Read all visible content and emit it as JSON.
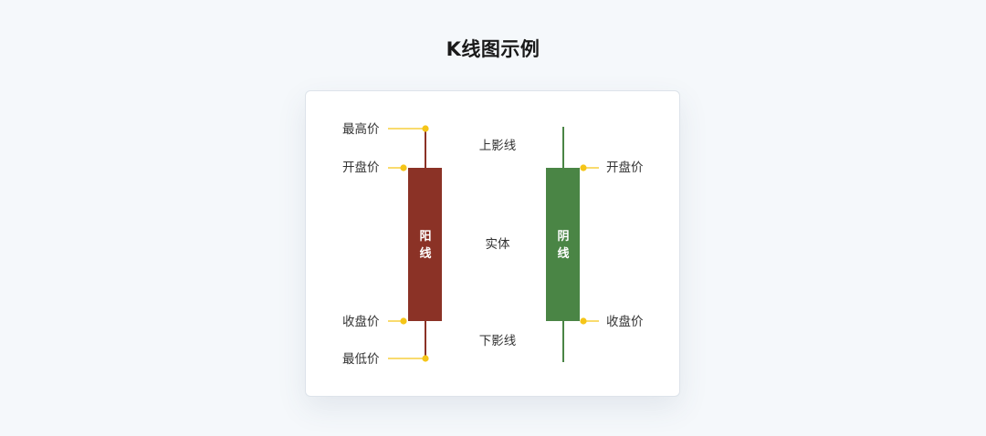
{
  "title": "K线图示例",
  "colors": {
    "yang": "#8b3226",
    "yin": "#4a8545",
    "marker": "#f5c518",
    "background": "#f5f8fb"
  },
  "yang_candle": {
    "body_label_line1": "阳",
    "body_label_line2": "线",
    "labels": {
      "high": "最高价",
      "open": "开盘价",
      "close": "收盘价",
      "low": "最低价"
    }
  },
  "center_labels": {
    "upper_shadow": "上影线",
    "body": "实体",
    "lower_shadow": "下影线"
  },
  "yin_candle": {
    "body_label_line1": "阴",
    "body_label_line2": "线",
    "labels": {
      "open": "开盘价",
      "close": "收盘价"
    }
  }
}
